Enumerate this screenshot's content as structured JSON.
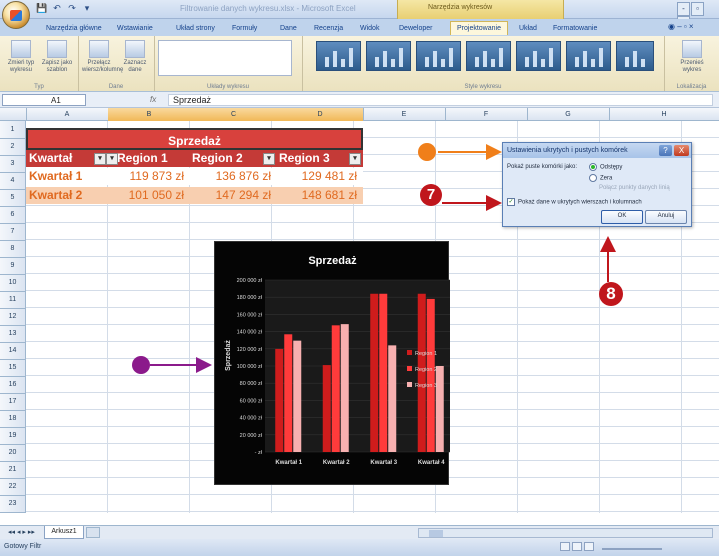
{
  "window": {
    "title": "Filtrowanie danych wykresu.xlsx - Microsoft Excel",
    "contextual_group": "Narzędzia wykresów",
    "controls": [
      "-",
      "▫",
      "x"
    ]
  },
  "qat": [
    "💾",
    "↶",
    "↷",
    "▾"
  ],
  "ribbon": {
    "tabs": [
      "Narzędzia główne",
      "Wstawianie",
      "Układ strony",
      "Formuły",
      "Dane",
      "Recenzja",
      "Widok",
      "Deweloper",
      "Projektowanie",
      "Układ",
      "Formatowanie"
    ],
    "active_tab": "Projektowanie",
    "groups": {
      "typ": {
        "label": "Typ",
        "btn1": "Zmień typ wykresu",
        "btn2": "Zapisz jako szablon"
      },
      "dane": {
        "label": "Dane",
        "btn1": "Przełącz wiersz/kolumnę",
        "btn2": "Zaznacz dane"
      },
      "uklady": {
        "label": "Układy wykresu"
      },
      "style": {
        "label": "Style wykresu"
      },
      "lokalizacja": {
        "label": "Lokalizacja",
        "btn1": "Przenieś wykres"
      }
    }
  },
  "formula_bar": {
    "name_box": "A1",
    "fx": "fx",
    "value": "Sprzedaż"
  },
  "columns": [
    "A",
    "B",
    "C",
    "D",
    "E",
    "F",
    "G",
    "H"
  ],
  "rows": [
    "1",
    "2",
    "3",
    "4",
    "5",
    "6",
    "7",
    "8",
    "9",
    "10",
    "11",
    "12",
    "13",
    "14",
    "15",
    "16",
    "17",
    "18",
    "19",
    "20",
    "21",
    "22",
    "23"
  ],
  "sheet": {
    "title": "Sprzedaż",
    "headers": [
      "Kwartał",
      "Region 1",
      "Region 2",
      "Region 3"
    ],
    "row1": [
      "Kwartał 1",
      "119 873 zł",
      "136 876 zł",
      "129 481 zł"
    ],
    "row2": [
      "Kwartał 2",
      "101 050 zł",
      "147 294 zł",
      "148 681 zł"
    ]
  },
  "dialog": {
    "title": "Ustawienia ukrytych i pustych komórek",
    "help": "?",
    "close": "X",
    "label": "Pokaż puste komórki jako:",
    "opt1": "Odstępy",
    "opt2": "Zera",
    "opt3": "Połącz punkty danych linią",
    "checkbox": "Pokaż dane w ukrytych wierszach i kolumnach",
    "ok": "OK",
    "cancel": "Anuluj"
  },
  "callouts": {
    "seven": "7",
    "eight": "8"
  },
  "colors": {
    "orange_dot": "#f07f1a",
    "purple_dot": "#8b1a8b",
    "red_callout": "#c0161c",
    "r1": "#cf1c1c",
    "r2": "#ff3b3b",
    "r3": "#f7b0b0"
  },
  "sheet_tabs": {
    "nav": "◂◂ ◂ ▸ ▸▸",
    "name": "Arkusz1"
  },
  "status": {
    "text": "Gotowy   Filtr"
  },
  "chart_data": {
    "type": "bar",
    "title": "Sprzedaż",
    "ylabel": "Sprzedaż",
    "xlabel": "",
    "categories": [
      "Kwartał 1",
      "Kwartał 2",
      "Kwartał 3",
      "Kwartał 4"
    ],
    "series": [
      {
        "name": "Region 1",
        "values": [
          119873,
          101050,
          184000,
          184000
        ]
      },
      {
        "name": "Region 2",
        "values": [
          136876,
          147294,
          184000,
          178000
        ]
      },
      {
        "name": "Region 3",
        "values": [
          129481,
          148681,
          124000,
          100000
        ]
      }
    ],
    "ylim": [
      0,
      200000
    ],
    "ytick_labels": [
      "200 000 zł",
      "180 000 zł",
      "160 000 zł",
      "140 000 zł",
      "120 000 zł",
      "100 000 zł",
      "80 000 zł",
      "60 000 zł",
      "40 000 zł",
      "20 000 zł",
      "- zł"
    ],
    "legend": "right",
    "grid": true
  }
}
